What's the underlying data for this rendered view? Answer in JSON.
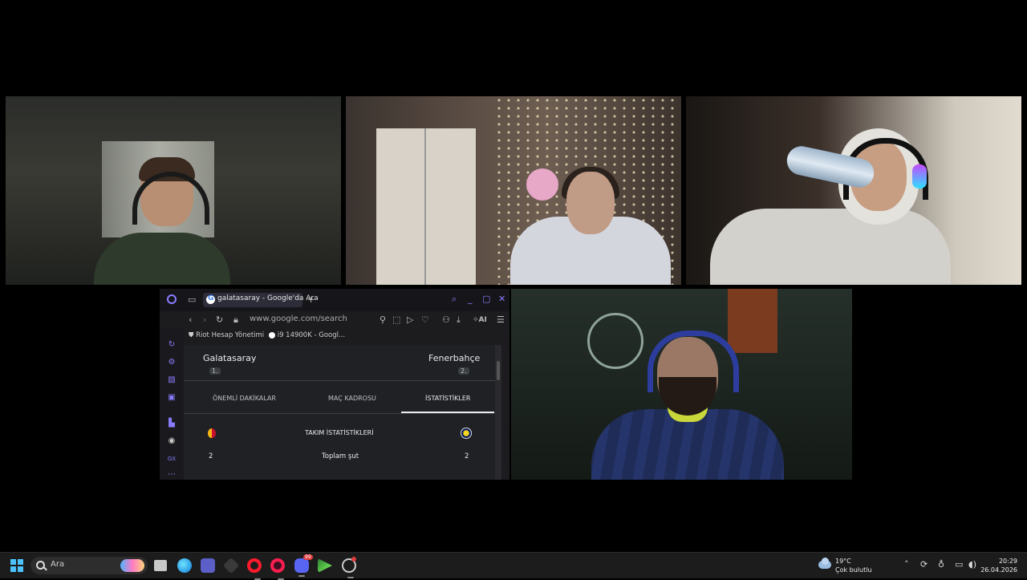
{
  "browser": {
    "tab_title": "galatasaray - Google'da Ara",
    "new_tab": "+",
    "url": "www.google.com/search",
    "ai_label": "AI",
    "bookmarks": [
      "Riot Hesap Yönetimi",
      "i9 14900K - Googl..."
    ]
  },
  "match": {
    "home_team": "Galatasaray",
    "home_rank": "1.",
    "away_team": "Fenerbahçe",
    "away_rank": "2.",
    "tabs": [
      "ÖNEMLİ DAKİKALAR",
      "MAÇ KADROSU",
      "İSTATİSTİKLER"
    ],
    "selected_tab": "İSTATİSTİKLER",
    "stats_header": "TAKIM İSTATİSTİKLERİ",
    "stats": [
      {
        "home": "2",
        "label": "Toplam şut",
        "away": "2"
      }
    ]
  },
  "taskbar": {
    "search_placeholder": "Ara",
    "weather_temp": "19°C",
    "weather_desc": "Çok bulutlu",
    "time": "20:29",
    "date": "26.04.2026",
    "discord_badge": "99"
  },
  "colors": {
    "active_speaker_border": "#5f8f62",
    "taskbar_bg": "#1c1c1c",
    "browser_accent": "#8a7cff"
  }
}
